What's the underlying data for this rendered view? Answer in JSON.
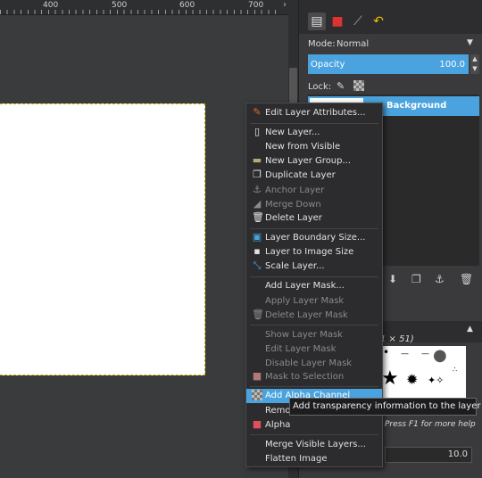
{
  "ruler": {
    "ticks": [
      "400",
      "500",
      "600",
      "700"
    ]
  },
  "dock": {
    "mode_label": "Mode:",
    "mode_value": "Normal",
    "opacity_label": "Opacity",
    "opacity_value": "100.0",
    "lock_label": "Lock:",
    "layer_name": "Background",
    "brush_size": "1 × 51)",
    "help_hint": "Press F1 for more help",
    "spacing_value": "10.0"
  },
  "menu": {
    "edit_attributes": "Edit Layer Attributes...",
    "new_layer": "New Layer...",
    "new_from_visible": "New from Visible",
    "new_group": "New Layer Group...",
    "duplicate": "Duplicate Layer",
    "anchor": "Anchor Layer",
    "merge_down": "Merge Down",
    "delete": "Delete Layer",
    "boundary_size": "Layer Boundary Size...",
    "to_image_size": "Layer to Image Size",
    "scale": "Scale Layer...",
    "add_mask": "Add Layer Mask...",
    "apply_mask": "Apply Layer Mask",
    "delete_mask": "Delete Layer Mask",
    "show_mask": "Show Layer Mask",
    "edit_mask": "Edit Layer Mask",
    "disable_mask": "Disable Layer Mask",
    "mask_to_selection": "Mask to Selection",
    "add_alpha": "Add Alpha Channel",
    "remove_alpha_partial": "Remo",
    "alpha_partial": "Alpha",
    "merge_visible": "Merge Visible Layers...",
    "flatten": "Flatten Image"
  },
  "tooltip": "Add transparency information to the layer",
  "colors": {
    "accent": "#4aa3de",
    "menu_bg": "#2c2c2e",
    "dock_bg": "#3a3a3c"
  }
}
